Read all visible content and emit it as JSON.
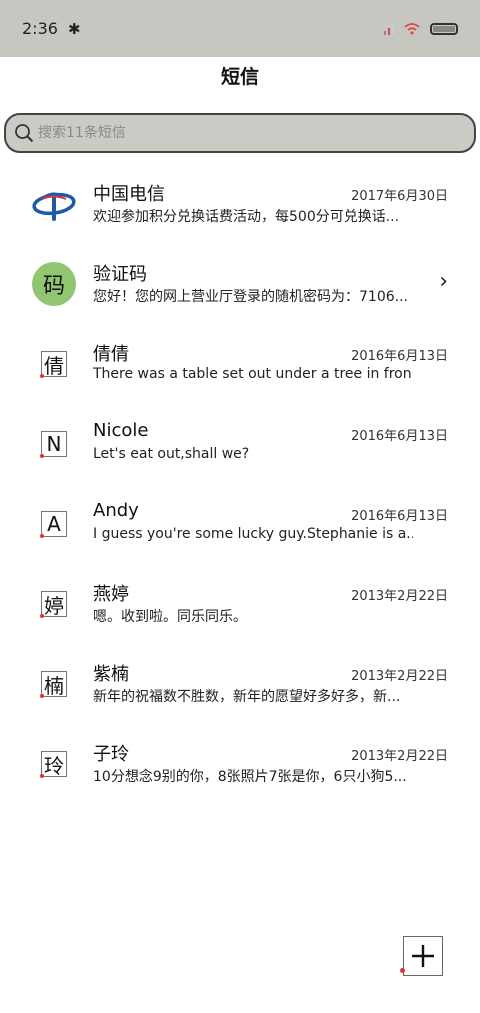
{
  "status": {
    "time": "2:36"
  },
  "header": {
    "title": "短信"
  },
  "search": {
    "placeholder": "搜索11条短信"
  },
  "conversations": [
    {
      "name": "中国电信",
      "date": "2017年6月30日",
      "preview": "欢迎参加积分兑换话费活动，每500分可兑换话...",
      "avatar": "telecom-logo"
    },
    {
      "name": "验证码",
      "date": "",
      "preview": "您好！您的网上营业厅登录的随机密码为：7106...",
      "avatar_text": "码"
    },
    {
      "name": "倩倩",
      "date": "2016年6月13日",
      "preview": "There was a table set out under a tree in fron...",
      "avatar_text": "倩"
    },
    {
      "name": "Nicole",
      "date": "2016年6月13日",
      "preview": "Let's eat out,shall we?",
      "avatar_text": "N"
    },
    {
      "name": "Andy",
      "date": "2016年6月13日",
      "preview": "I guess you're some lucky guy.Stephanie is a...",
      "avatar_text": "A"
    },
    {
      "name": "燕婷",
      "date": "2013年2月22日",
      "preview": "嗯。收到啦。同乐同乐。",
      "avatar_text": "婷"
    },
    {
      "name": "紫楠",
      "date": "2013年2月22日",
      "preview": "新年的祝福数不胜数，新年的愿望好多好多，新...",
      "avatar_text": "楠"
    },
    {
      "name": "子玲",
      "date": "2013年2月22日",
      "preview": "10分想念9别的你，8张照片7张是你，6只小狗5...",
      "avatar_text": "玲"
    }
  ],
  "colors": {
    "statusbar": "#c7c6c0",
    "search_bg": "#cbcac4",
    "avatar_green": "#92c572",
    "telecom_blue": "#1f5aa8"
  }
}
